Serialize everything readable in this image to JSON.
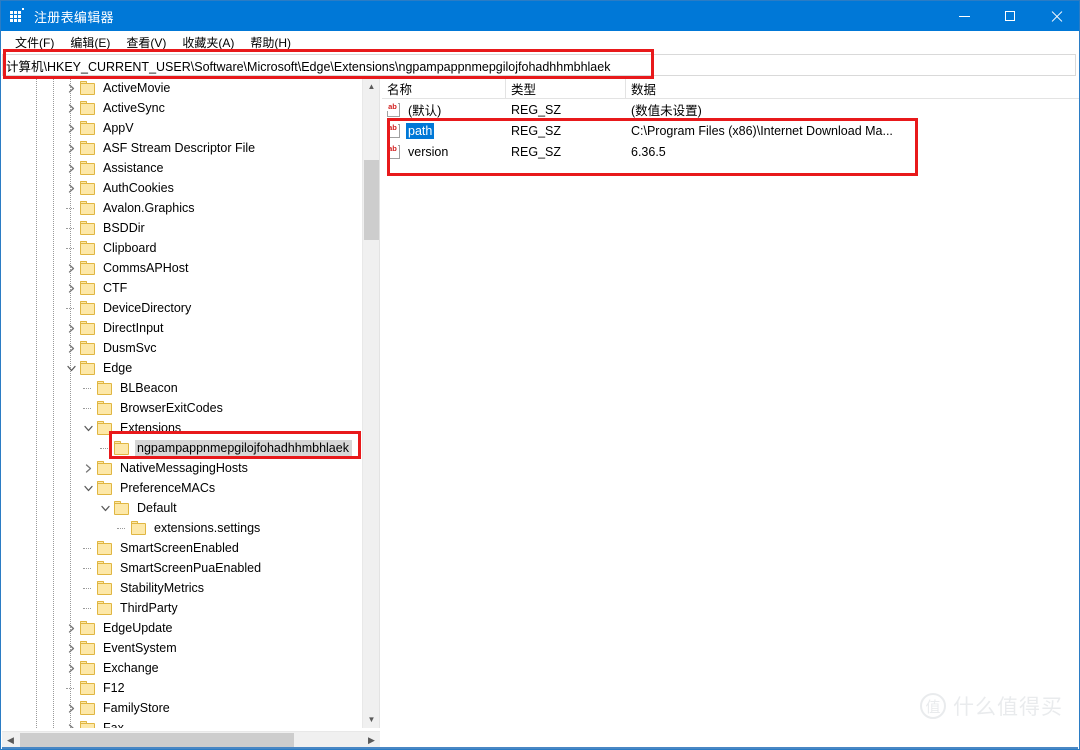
{
  "window": {
    "title": "注册表编辑器",
    "icon": "registry-icon",
    "controls": {
      "minimize": "minimize-icon",
      "maximize": "maximize-icon",
      "close": "close-icon"
    }
  },
  "menubar": {
    "items": [
      {
        "label": "文件(F)"
      },
      {
        "label": "编辑(E)"
      },
      {
        "label": "查看(V)"
      },
      {
        "label": "收藏夹(A)"
      },
      {
        "label": "帮助(H)"
      }
    ]
  },
  "address": {
    "value": "计算机\\HKEY_CURRENT_USER\\Software\\Microsoft\\Edge\\Extensions\\ngpampappnmepgilojfohadhhmbhlaek"
  },
  "tree": {
    "nodes": [
      {
        "label": "ActiveMovie",
        "depth": 3,
        "state": "collapsed",
        "selected": false
      },
      {
        "label": "ActiveSync",
        "depth": 3,
        "state": "collapsed",
        "selected": false
      },
      {
        "label": "AppV",
        "depth": 3,
        "state": "collapsed",
        "selected": false
      },
      {
        "label": "ASF Stream Descriptor File",
        "depth": 3,
        "state": "collapsed",
        "selected": false
      },
      {
        "label": "Assistance",
        "depth": 3,
        "state": "collapsed",
        "selected": false
      },
      {
        "label": "AuthCookies",
        "depth": 3,
        "state": "collapsed",
        "selected": false
      },
      {
        "label": "Avalon.Graphics",
        "depth": 3,
        "state": "leaf",
        "selected": false
      },
      {
        "label": "BSDDir",
        "depth": 3,
        "state": "leaf",
        "selected": false
      },
      {
        "label": "Clipboard",
        "depth": 3,
        "state": "leaf",
        "selected": false
      },
      {
        "label": "CommsAPHost",
        "depth": 3,
        "state": "collapsed",
        "selected": false
      },
      {
        "label": "CTF",
        "depth": 3,
        "state": "collapsed",
        "selected": false
      },
      {
        "label": "DeviceDirectory",
        "depth": 3,
        "state": "leaf",
        "selected": false
      },
      {
        "label": "DirectInput",
        "depth": 3,
        "state": "collapsed",
        "selected": false
      },
      {
        "label": "DusmSvc",
        "depth": 3,
        "state": "collapsed",
        "selected": false
      },
      {
        "label": "Edge",
        "depth": 3,
        "state": "expanded",
        "selected": false
      },
      {
        "label": "BLBeacon",
        "depth": 4,
        "state": "leaf",
        "selected": false
      },
      {
        "label": "BrowserExitCodes",
        "depth": 4,
        "state": "leaf",
        "selected": false
      },
      {
        "label": "Extensions",
        "depth": 4,
        "state": "expanded",
        "selected": false
      },
      {
        "label": "ngpampappnmepgilojfohadhhmbhlaek",
        "depth": 5,
        "state": "leaf",
        "selected": true
      },
      {
        "label": "NativeMessagingHosts",
        "depth": 4,
        "state": "collapsed",
        "selected": false
      },
      {
        "label": "PreferenceMACs",
        "depth": 4,
        "state": "expanded",
        "selected": false
      },
      {
        "label": "Default",
        "depth": 5,
        "state": "expanded",
        "selected": false
      },
      {
        "label": "extensions.settings",
        "depth": 6,
        "state": "leaf",
        "selected": false
      },
      {
        "label": "SmartScreenEnabled",
        "depth": 4,
        "state": "leaf",
        "selected": false
      },
      {
        "label": "SmartScreenPuaEnabled",
        "depth": 4,
        "state": "leaf",
        "selected": false
      },
      {
        "label": "StabilityMetrics",
        "depth": 4,
        "state": "leaf",
        "selected": false
      },
      {
        "label": "ThirdParty",
        "depth": 4,
        "state": "leaf",
        "selected": false
      },
      {
        "label": "EdgeUpdate",
        "depth": 3,
        "state": "collapsed",
        "selected": false
      },
      {
        "label": "EventSystem",
        "depth": 3,
        "state": "collapsed",
        "selected": false
      },
      {
        "label": "Exchange",
        "depth": 3,
        "state": "collapsed",
        "selected": false
      },
      {
        "label": "F12",
        "depth": 3,
        "state": "leaf",
        "selected": false
      },
      {
        "label": "FamilyStore",
        "depth": 3,
        "state": "collapsed",
        "selected": false
      },
      {
        "label": "Fax",
        "depth": 3,
        "state": "collapsed",
        "selected": false
      }
    ]
  },
  "values": {
    "columns": [
      {
        "label": "名称"
      },
      {
        "label": "类型"
      },
      {
        "label": "数据"
      }
    ],
    "rows": [
      {
        "name": "(默认)",
        "type": "REG_SZ",
        "data": "(数值未设置)",
        "selected": false
      },
      {
        "name": "path",
        "type": "REG_SZ",
        "data": "C:\\Program Files (x86)\\Internet Download Ma...",
        "selected": true
      },
      {
        "name": "version",
        "type": "REG_SZ",
        "data": "6.36.5",
        "selected": false
      }
    ]
  },
  "scrollbars": {
    "tree_vertical": {
      "up": "chevron-up-icon",
      "down": "chevron-down-icon"
    },
    "tree_horizontal": {
      "left": "chevron-left-icon",
      "right": "chevron-right-icon"
    }
  },
  "watermark": {
    "badge": "值",
    "text": "什么值得买"
  },
  "colors": {
    "titlebar": "#0078d7",
    "annotation": "#e8191b",
    "selection": "#0078d7",
    "tree_selection": "#d6d6d6",
    "folder": "#fde8a8"
  }
}
